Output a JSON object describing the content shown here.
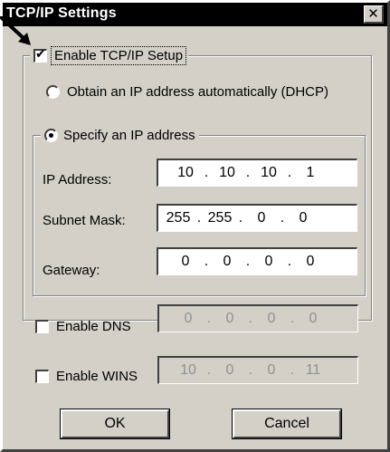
{
  "window": {
    "title": "TCP/IP Settings",
    "close_glyph": "✕"
  },
  "enable_tcpip": {
    "label": "Enable TCP/IP Setup",
    "checked": true,
    "check_glyph": "✔"
  },
  "dhcp_option": {
    "label": "Obtain an IP address automatically (DHCP)",
    "selected": false
  },
  "specify_option": {
    "label": "Specify an IP address",
    "selected": true
  },
  "ip_address": {
    "label": "IP Address:",
    "octets": [
      "10",
      "10",
      "10",
      "1"
    ]
  },
  "subnet_mask": {
    "label": "Subnet Mask:",
    "octets": [
      "255",
      "255",
      "0",
      "0"
    ]
  },
  "gateway": {
    "label": "Gateway:",
    "octets": [
      "0",
      "0",
      "0",
      "0"
    ]
  },
  "dns": {
    "label": "Enable DNS",
    "checked": false,
    "octets": [
      "0",
      "0",
      "0",
      "0"
    ]
  },
  "wins": {
    "label": "Enable WINS",
    "checked": false,
    "octets": [
      "10",
      "0",
      "0",
      "11"
    ]
  },
  "buttons": {
    "ok": "OK",
    "cancel": "Cancel"
  },
  "separator_glyph": "."
}
